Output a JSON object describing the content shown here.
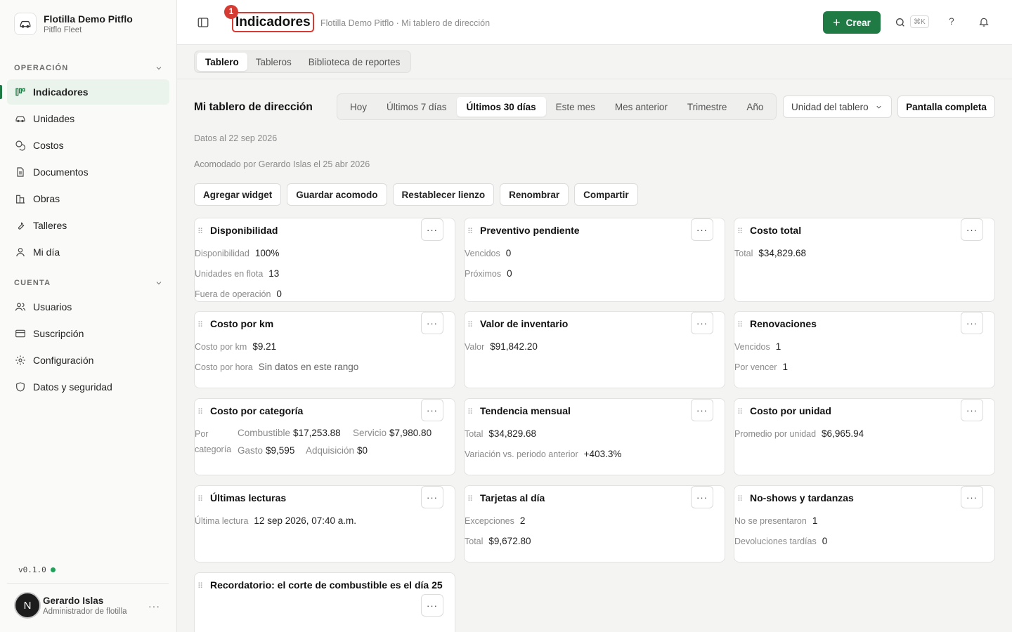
{
  "org": {
    "name": "Flotilla Demo Pitflo",
    "sub": "Pitflo Fleet"
  },
  "sidebar": {
    "section_operacion": "OPERACIÓN",
    "section_cuenta": "CUENTA",
    "operacion": [
      {
        "label": "Indicadores",
        "icon": "chart-bars-icon",
        "active": true
      },
      {
        "label": "Unidades",
        "icon": "car-icon"
      },
      {
        "label": "Costos",
        "icon": "coins-icon"
      },
      {
        "label": "Documentos",
        "icon": "document-icon"
      },
      {
        "label": "Obras",
        "icon": "buildings-icon"
      },
      {
        "label": "Talleres",
        "icon": "wrench-icon"
      },
      {
        "label": "Mi día",
        "icon": "user-icon"
      }
    ],
    "cuenta": [
      {
        "label": "Usuarios",
        "icon": "users-icon"
      },
      {
        "label": "Suscripción",
        "icon": "credit-card-icon"
      },
      {
        "label": "Configuración",
        "icon": "gear-icon"
      },
      {
        "label": "Datos y seguridad",
        "icon": "shield-icon"
      }
    ],
    "version": "v0.1.0",
    "user": {
      "initial": "N",
      "name": "Gerardo Islas",
      "role": "Administrador de flotilla",
      "more": "···"
    }
  },
  "topbar": {
    "title": "Indicadores",
    "badge": "1",
    "breadcrumb": "Flotilla Demo Pitflo · Mi tablero de dirección",
    "crear_label": "Crear",
    "kbd": "⌘K",
    "help": "?",
    "accent": "#1f7a44"
  },
  "tabs": [
    "Tablero",
    "Tableros",
    "Biblioteca de reportes"
  ],
  "dashboard": {
    "title": "Mi tablero de dirección",
    "ranges": [
      "Hoy",
      "Últimos 7 días",
      "Últimos 30 días",
      "Este mes",
      "Mes anterior",
      "Trimestre",
      "Año"
    ],
    "active_range": "Últimos 30 días",
    "unit_select": "Unidad del tablero",
    "fullscreen": "Pantalla completa",
    "data_as_of": "Datos al 22 sep 2026",
    "arranged_by": "Acomodado por Gerardo Islas el 25 abr 2026",
    "actions": [
      "Agregar widget",
      "Guardar acomodo",
      "Restablecer lienzo",
      "Renombrar",
      "Compartir"
    ]
  },
  "widgets": {
    "disponibilidad": {
      "title": "Disponibilidad",
      "rows": [
        [
          "Disponibilidad",
          "100%"
        ],
        [
          "Unidades en flota",
          "13"
        ],
        [
          "Fuera de operación",
          "0"
        ]
      ]
    },
    "preventivo": {
      "title": "Preventivo pendiente",
      "rows": [
        [
          "Vencidos",
          "0"
        ],
        [
          "Próximos",
          "0"
        ]
      ]
    },
    "costo_total": {
      "title": "Costo total",
      "rows": [
        [
          "Total",
          "$34,829.68"
        ]
      ]
    },
    "costo_km": {
      "title": "Costo por km",
      "rows": [
        [
          "Costo por km",
          "$9.21"
        ],
        [
          "Costo por hora",
          "Sin datos en este rango"
        ]
      ]
    },
    "inventario": {
      "title": "Valor de inventario",
      "rows": [
        [
          "Valor",
          "$91,842.20"
        ]
      ]
    },
    "renovaciones": {
      "title": "Renovaciones",
      "rows": [
        [
          "Vencidos",
          "1"
        ],
        [
          "Por vencer",
          "1"
        ]
      ]
    },
    "categoria": {
      "title": "Costo por categoría",
      "label1": "Por",
      "label2": "categoría",
      "items": [
        [
          "Combustible",
          "$17,253.88"
        ],
        [
          "Servicio",
          "$7,980.80"
        ],
        [
          "Gasto",
          "$9,595"
        ],
        [
          "Adquisición",
          "$0"
        ]
      ]
    },
    "tendencia": {
      "title": "Tendencia mensual",
      "rows": [
        [
          "Total",
          "$34,829.68"
        ],
        [
          "Variación vs. periodo anterior",
          "+403.3%"
        ]
      ]
    },
    "costo_unidad": {
      "title": "Costo por unidad",
      "rows": [
        [
          "Promedio por unidad",
          "$6,965.94"
        ]
      ]
    },
    "lecturas": {
      "title": "Últimas lecturas",
      "rows": [
        [
          "Última lectura",
          "12 sep 2026, 07:40 a.m."
        ]
      ]
    },
    "tarjetas": {
      "title": "Tarjetas al día",
      "rows": [
        [
          "Excepciones",
          "2"
        ],
        [
          "Total",
          "$9,672.80"
        ]
      ]
    },
    "noshows": {
      "title": "No-shows y tardanzas",
      "rows": [
        [
          "No se presentaron",
          "1"
        ],
        [
          "Devoluciones tardías",
          "0"
        ]
      ]
    },
    "recordatorio": {
      "title": "Recordatorio: el corte de combustible es el día 25"
    },
    "more": "···"
  }
}
